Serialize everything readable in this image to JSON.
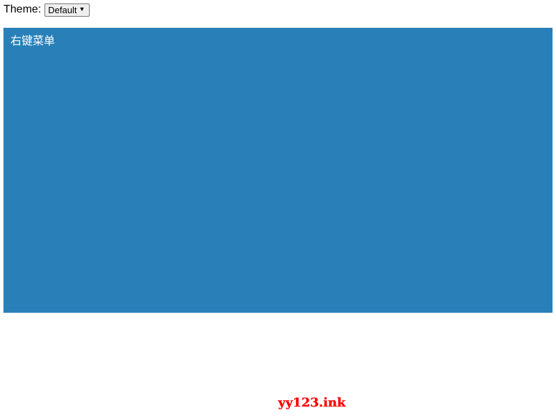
{
  "theme": {
    "label": "Theme:",
    "selected": "Default",
    "chevron_icon": "chevron-down-icon"
  },
  "context_area": {
    "label": "右键菜单",
    "background_color": "#2980b9",
    "text_color": "#ffffff"
  },
  "watermark": {
    "text": "yy123.ink",
    "color": "#ff0000"
  }
}
